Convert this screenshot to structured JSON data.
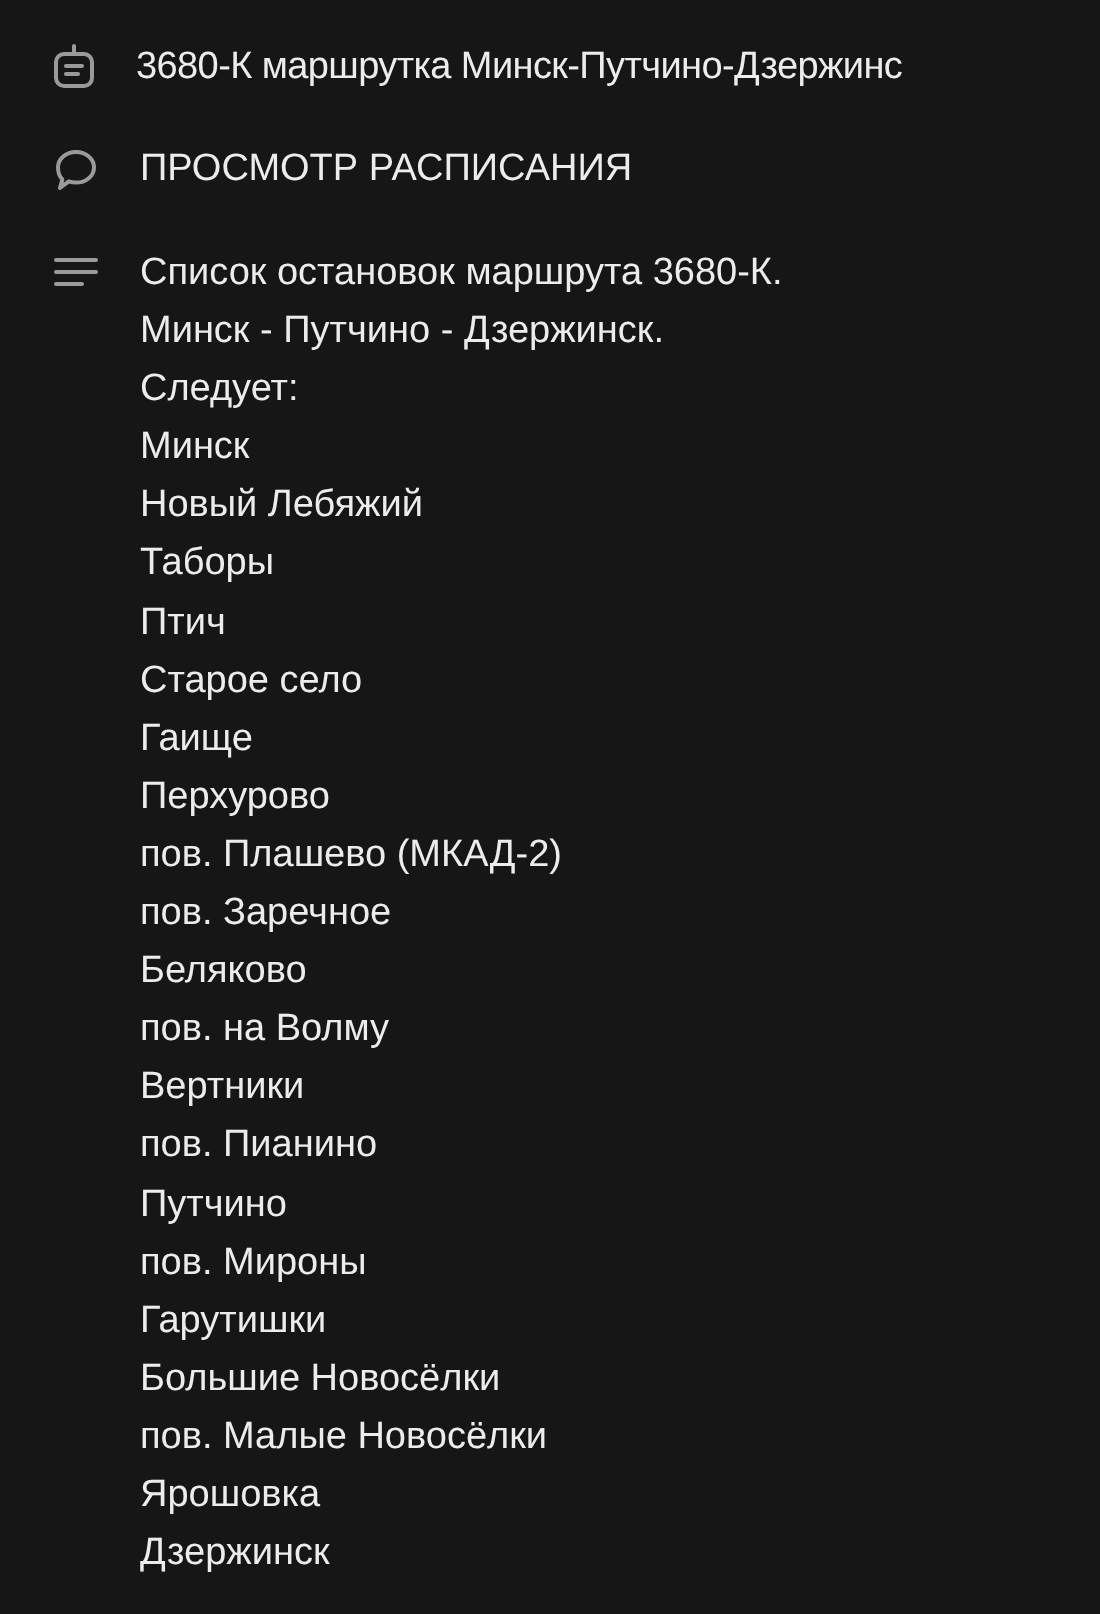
{
  "title": "3680-К маршрутка Минск-Путчино-Дзержинс",
  "section": "ПРОСМОТР РАСПИСАНИЯ",
  "description": [
    "Список остановок маршрута 3680-К.",
    "Минск - Путчино - Дзержинск.",
    "Следует:",
    "Минск",
    "Новый Лебяжий",
    "Таборы",
    "Птич",
    "Старое село",
    "Гаище",
    "Перхурово",
    "пов. Плашево (МКАД-2)",
    "пов. Заречное",
    "Беляково",
    "пов. на Волму",
    "Вертники",
    "пов. Пианино",
    "Путчино",
    "пов. Мироны",
    "Гарутишки",
    "Большие Новосёлки",
    "пов. Малые Новосёлки",
    "Ярошовка",
    "Дзержинск"
  ]
}
